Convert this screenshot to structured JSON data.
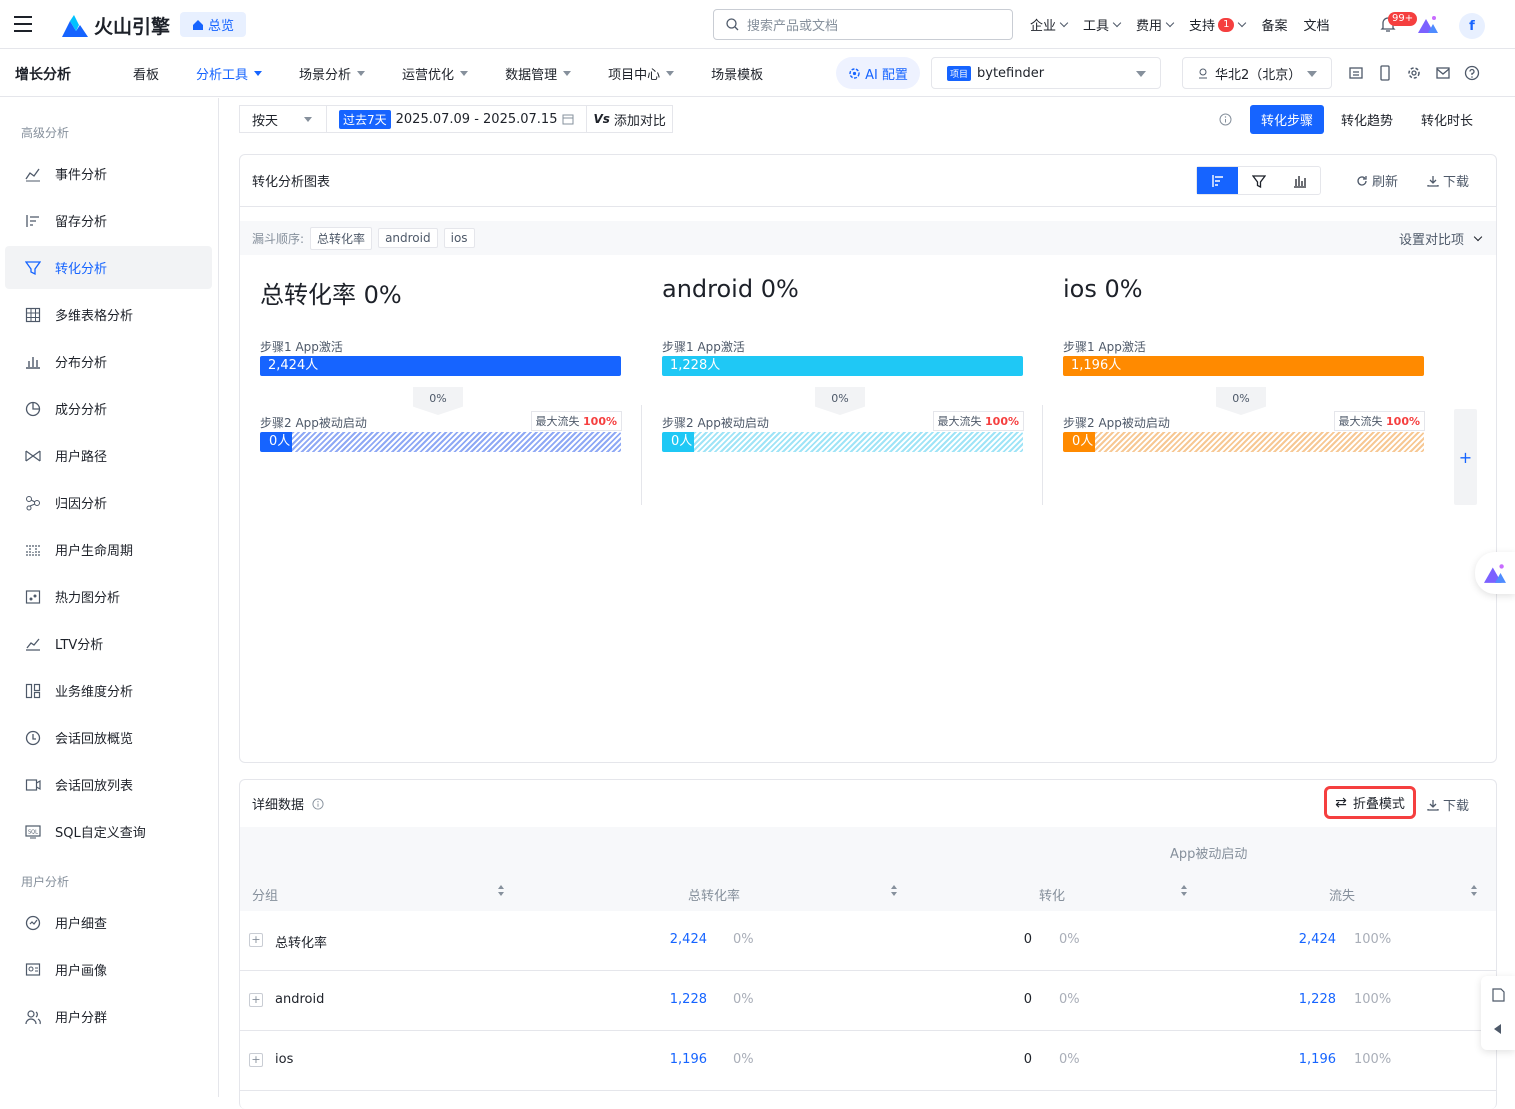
{
  "topbar": {
    "logo_text": "火山引擎",
    "home_label": "总览",
    "search_placeholder": "搜索产品或文档",
    "nav": [
      {
        "label": "企业"
      },
      {
        "label": "工具"
      },
      {
        "label": "费用"
      },
      {
        "label": "支持",
        "badge": "1"
      },
      {
        "label": "备案"
      },
      {
        "label": "文档"
      }
    ],
    "bell_badge": "99+",
    "avatar_letter": "f"
  },
  "subbar": {
    "brand": "增长分析",
    "menu": [
      {
        "label": "看板",
        "active": false
      },
      {
        "label": "分析工具",
        "active": true
      },
      {
        "label": "场景分析",
        "active": false
      },
      {
        "label": "运营优化",
        "active": false
      },
      {
        "label": "数据管理",
        "active": false
      },
      {
        "label": "项目中心",
        "active": false
      },
      {
        "label": "场景模板",
        "active": false
      }
    ],
    "ai_config": "AI 配置",
    "project_tag": "项目",
    "project_name": "bytefinder",
    "region": "华北2（北京）"
  },
  "sidebar": {
    "section1": "高级分析",
    "items": [
      {
        "label": "事件分析",
        "icon": "line-chart-icon"
      },
      {
        "label": "留存分析",
        "icon": "retention-icon"
      },
      {
        "label": "转化分析",
        "icon": "funnel-icon"
      },
      {
        "label": "多维表格分析",
        "icon": "table-grid-icon"
      },
      {
        "label": "分布分析",
        "icon": "bar-chart-icon"
      },
      {
        "label": "成分分析",
        "icon": "pie-icon"
      },
      {
        "label": "用户路径",
        "icon": "path-icon"
      },
      {
        "label": "归因分析",
        "icon": "attribution-icon"
      },
      {
        "label": "用户生命周期",
        "icon": "lifecycle-icon"
      },
      {
        "label": "热力图分析",
        "icon": "heatmap-icon"
      },
      {
        "label": "LTV分析",
        "icon": "ltv-icon"
      },
      {
        "label": "业务维度分析",
        "icon": "dimension-icon"
      },
      {
        "label": "会话回放概览",
        "icon": "replay-overview-icon"
      },
      {
        "label": "会话回放列表",
        "icon": "replay-list-icon"
      },
      {
        "label": "SQL自定义查询",
        "icon": "sql-icon"
      }
    ],
    "section2": "用户分析",
    "items2": [
      {
        "label": "用户细查",
        "icon": "user-detail-icon"
      },
      {
        "label": "用户画像",
        "icon": "user-profile-icon"
      },
      {
        "label": "用户分群",
        "icon": "user-group-icon"
      }
    ],
    "active_index": 2
  },
  "controls": {
    "period": "按天",
    "range_pill": "过去7天",
    "range": "2025.07.09 - 2025.07.15",
    "add_compare": "添加对比",
    "tabs": [
      "转化步骤",
      "转化趋势",
      "转化时长"
    ],
    "active_tab": 0
  },
  "chart_card": {
    "title": "转化分析图表",
    "refresh": "刷新",
    "download": "下载",
    "funnel_order_label": "漏斗顺序:",
    "chips": [
      "总转化率",
      "android",
      "ios"
    ],
    "set_compare": "设置对比项",
    "max_loss_label": "最大流失",
    "step1_label": "步骤1 App激活",
    "step2_label": "步骤2 App被动启动"
  },
  "chart_data": {
    "type": "bar",
    "panels": [
      {
        "title": "总转化率 0%",
        "step1": "2,424人",
        "conv": "0%",
        "max_loss": "100%",
        "step2": "0人",
        "step1_value": 2424,
        "step2_value": 0,
        "color": "#1664ff",
        "hatch": "#8fa9f5"
      },
      {
        "title": "android 0%",
        "step1": "1,228人",
        "conv": "0%",
        "max_loss": "100%",
        "step2": "0人",
        "step1_value": 1228,
        "step2_value": 0,
        "color": "#1fc8f5",
        "hatch": "#9fe4f7"
      },
      {
        "title": "ios 0%",
        "step1": "1,196人",
        "conv": "0%",
        "max_loss": "100%",
        "step2": "0人",
        "step1_value": 1196,
        "step2_value": 0,
        "color": "#ff8a00",
        "hatch": "#f7c894"
      }
    ]
  },
  "detail": {
    "title": "详细数据",
    "collapse_mode": "折叠模式",
    "download": "下载",
    "group_header": "App被动启动",
    "columns": [
      "分组",
      "总转化率",
      "转化",
      "流失"
    ],
    "rows": [
      {
        "name": "总转化率",
        "total": "2,424",
        "total_pct": "0%",
        "conv": "0",
        "conv_pct": "0%",
        "loss": "2,424",
        "loss_pct": "100%"
      },
      {
        "name": "android",
        "total": "1,228",
        "total_pct": "0%",
        "conv": "0",
        "conv_pct": "0%",
        "loss": "1,228",
        "loss_pct": "100%"
      },
      {
        "name": "ios",
        "total": "1,196",
        "total_pct": "0%",
        "conv": "0",
        "conv_pct": "0%",
        "loss": "1,196",
        "loss_pct": "100%"
      }
    ]
  },
  "colors": {
    "accent": "#1664ff",
    "danger": "#f53f3f"
  }
}
